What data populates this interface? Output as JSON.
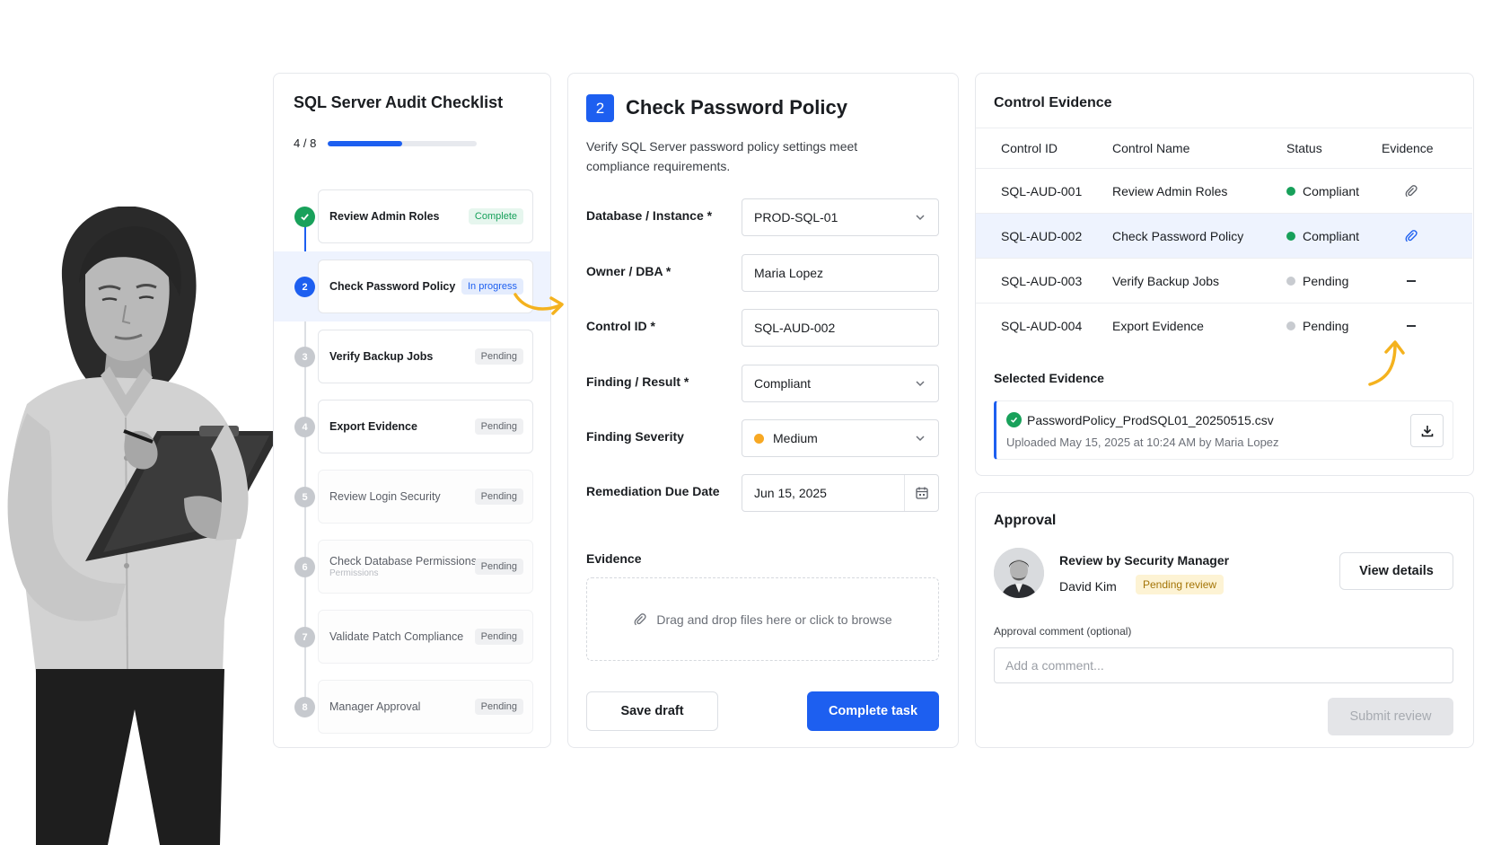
{
  "checklist": {
    "title": "SQL Server Audit Checklist",
    "progress_text": "4 / 8",
    "progress_fraction": 0.5,
    "items": [
      {
        "num": "1",
        "label": "Review Admin Roles",
        "status": "Complete"
      },
      {
        "num": "2",
        "label": "Check Password Policy",
        "status": "In progress"
      },
      {
        "num": "3",
        "label": "Verify Backup Jobs",
        "status": "Pending"
      },
      {
        "num": "4",
        "label": "Export Evidence",
        "status": "Pending"
      },
      {
        "num": "5",
        "label": "Review Login Security",
        "status": "Pending"
      },
      {
        "num": "6",
        "label": "Check Database Permissions",
        "ghost": "Permissions",
        "status": "Pending"
      },
      {
        "num": "7",
        "label": "Validate Patch Compliance",
        "status": "Pending"
      },
      {
        "num": "8",
        "label": "Manager Approval",
        "status": "Pending"
      }
    ]
  },
  "task": {
    "step": "2",
    "title": "Check Password Policy",
    "description": "Verify SQL Server password policy settings meet compliance requirements.",
    "fields": {
      "database": {
        "label": "Database / Instance *",
        "value": "PROD-SQL-01"
      },
      "owner": {
        "label": "Owner / DBA *",
        "value": "Maria Lopez"
      },
      "control_id": {
        "label": "Control ID *",
        "value": "SQL-AUD-002"
      },
      "finding": {
        "label": "Finding / Result *",
        "value": "Compliant"
      },
      "severity": {
        "label": "Finding Severity",
        "value": "Medium"
      },
      "due_date": {
        "label": "Remediation Due Date",
        "value": "Jun 15, 2025"
      }
    },
    "evidence_label": "Evidence",
    "dropzone_text": "Drag and drop files here or click to browse",
    "save_label": "Save draft",
    "complete_label": "Complete task"
  },
  "evidence": {
    "title": "Control Evidence",
    "columns": [
      "Control ID",
      "Control Name",
      "Status",
      "Evidence"
    ],
    "rows": [
      {
        "id": "SQL-AUD-001",
        "name": "Review Admin Roles",
        "status": "Compliant",
        "evidence": "attached"
      },
      {
        "id": "SQL-AUD-002",
        "name": "Check Password Policy",
        "status": "Compliant",
        "evidence": "attached"
      },
      {
        "id": "SQL-AUD-003",
        "name": "Verify Backup Jobs",
        "status": "Pending",
        "evidence": "none"
      },
      {
        "id": "SQL-AUD-004",
        "name": "Export Evidence",
        "status": "Pending",
        "evidence": "none"
      }
    ],
    "selected_title": "Selected Evidence",
    "file_name": "PasswordPolicy_ProdSQL01_20250515.csv",
    "file_meta": "Uploaded May 15, 2025 at 10:24 AM by Maria Lopez"
  },
  "approval": {
    "title": "Approval",
    "role": "Review by Security Manager",
    "name": "David Kim",
    "badge": "Pending review",
    "view_details_label": "View details",
    "comment_label": "Approval comment (optional)",
    "comment_placeholder": "Add a comment...",
    "submit_label": "Submit review"
  },
  "colors": {
    "accent": "#1d5ff0",
    "success": "#19a15b",
    "warning": "#f7a823",
    "arrow": "#f4b21e"
  }
}
